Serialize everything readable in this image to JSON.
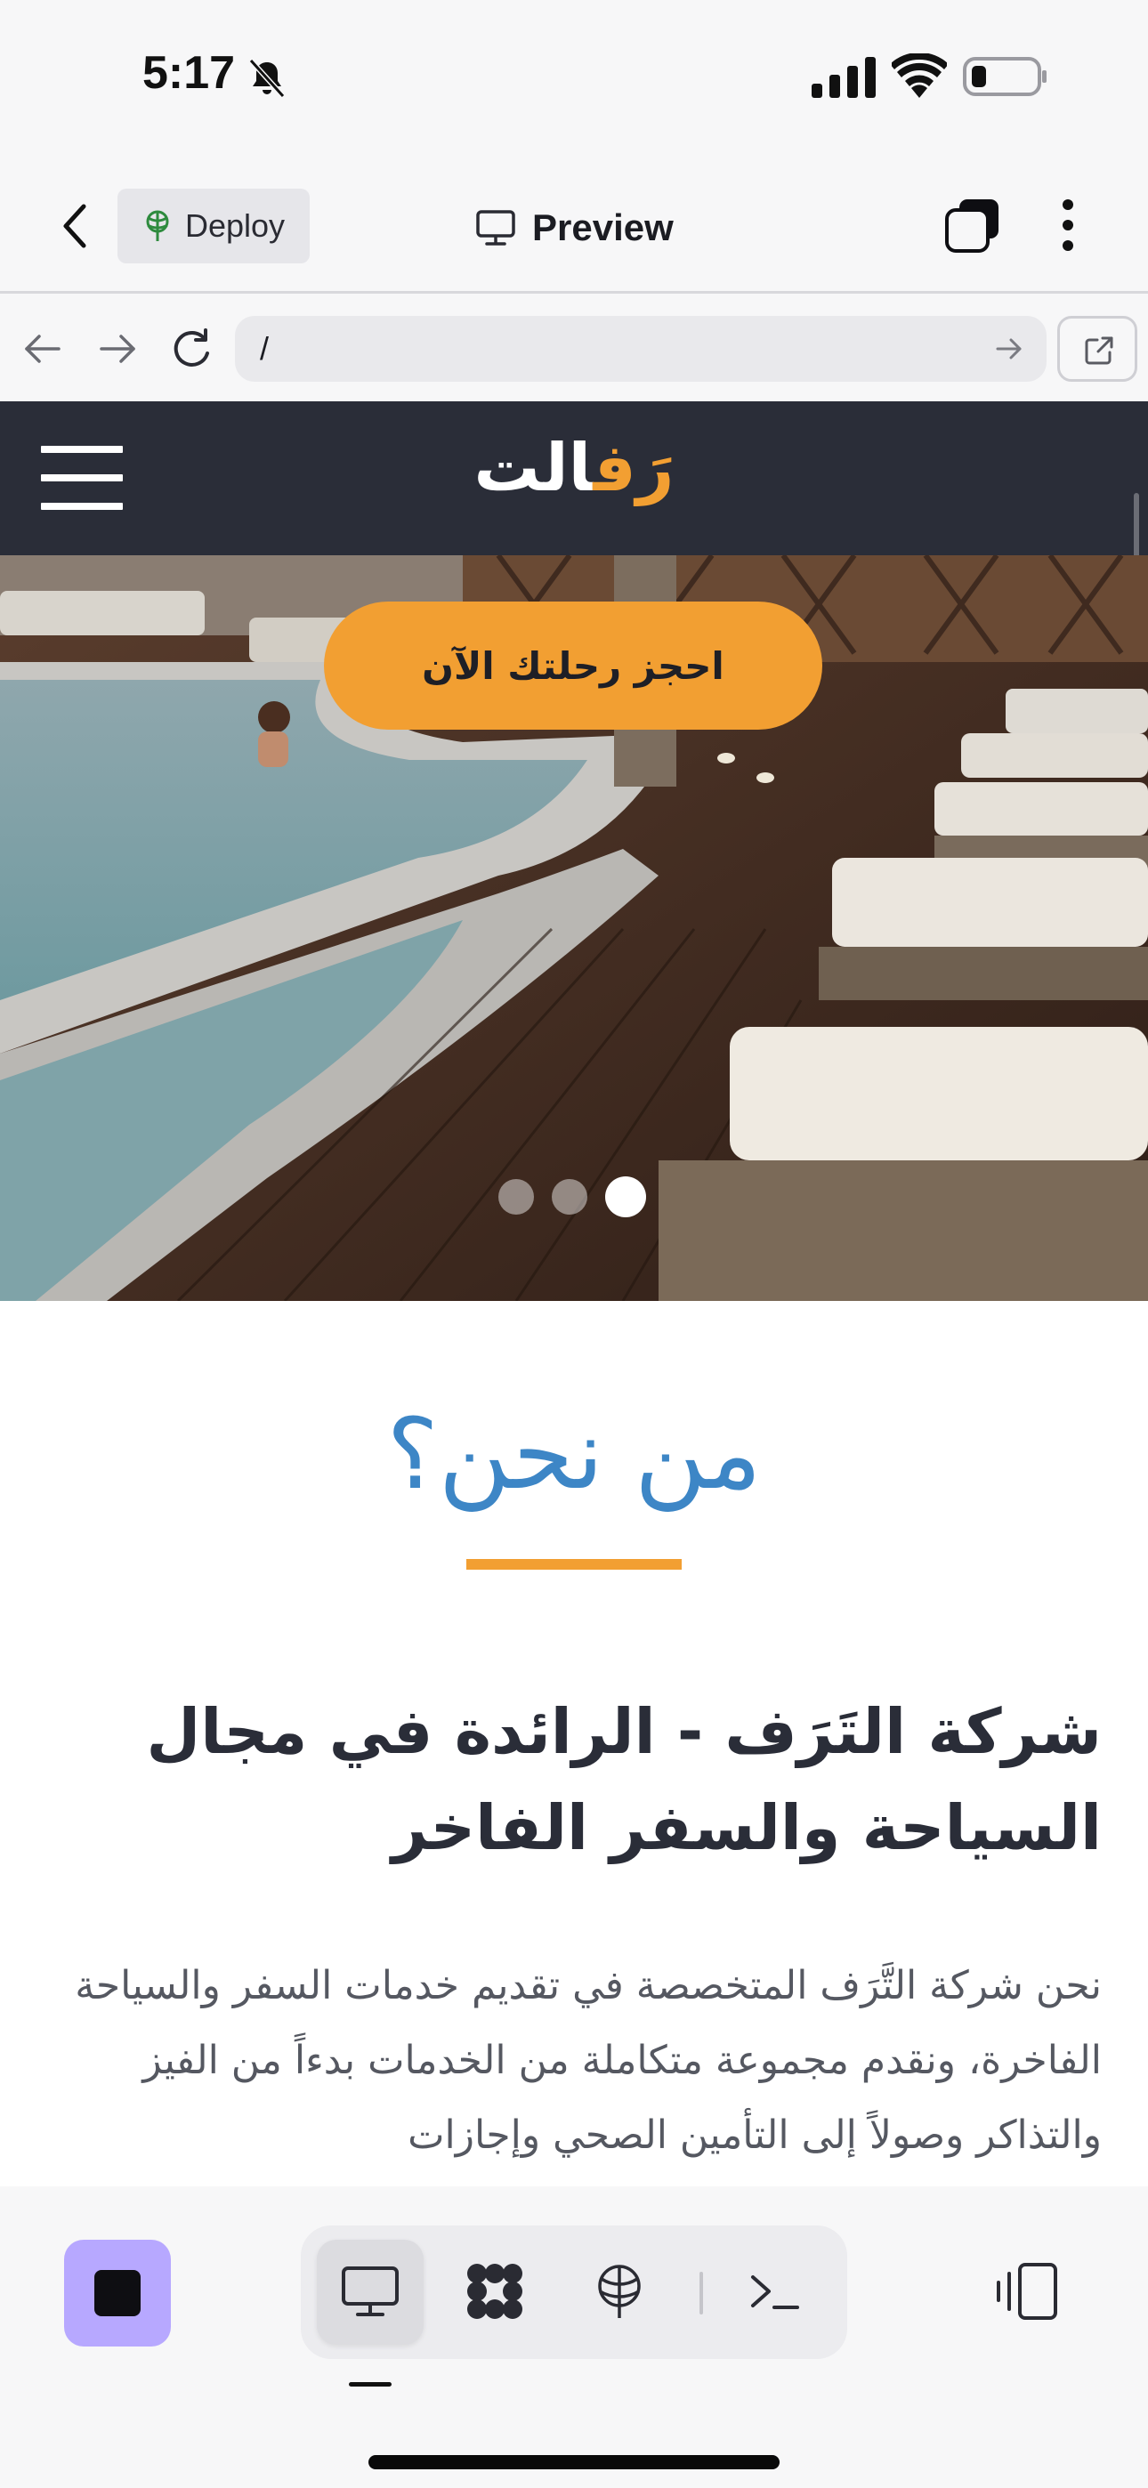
{
  "status_bar": {
    "time": "5:17",
    "icons": [
      "bell-slash-icon",
      "cellular-signal-icon",
      "wifi-icon",
      "battery-icon"
    ]
  },
  "app_header": {
    "back_icon": "chevron-left-icon",
    "deploy_label": "Deploy",
    "title": "Preview",
    "title_icon": "monitor-icon"
  },
  "browser": {
    "url": "/"
  },
  "site": {
    "logo_part1": "الت",
    "logo_part2": "رَف",
    "cta_label": "احجز رحلتك الآن",
    "slides": {
      "count": 3,
      "active": 3
    },
    "colors": {
      "nav_bg": "#2a2d38",
      "accent": "#f29f32",
      "title_blue": "#3d86c6"
    }
  },
  "about": {
    "title": "من نحن؟",
    "heading": "شركة التَرَف - الرائدة في مجال السياحة والسفر الفاخر",
    "body": "نحن شركة التَّرَف المتخصصة في تقديم خدمات السفر والسياحة الفاخرة، ونقدم مجموعة متكاملة من الخدمات بدءاً من الفيز والتذاكر وصولاً إلى التأمين الصحي وإجازات"
  },
  "bottom_bar": {
    "tools": [
      "monitor-icon",
      "grid-icon",
      "deploy-icon",
      "terminal-icon"
    ],
    "active_tool": "monitor-icon",
    "accent": "#b7a8ff"
  }
}
